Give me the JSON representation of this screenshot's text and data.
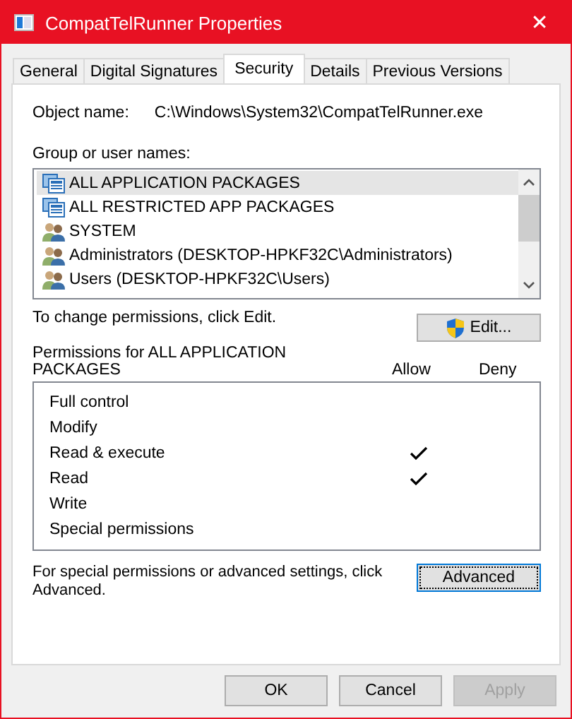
{
  "window": {
    "title": "CompatTelRunner Properties",
    "close": "✕"
  },
  "tabs": [
    {
      "label": "General",
      "selected": false
    },
    {
      "label": "Digital Signatures",
      "selected": false
    },
    {
      "label": "Security",
      "selected": true
    },
    {
      "label": "Details",
      "selected": false
    },
    {
      "label": "Previous Versions",
      "selected": false
    }
  ],
  "object_name": {
    "label": "Object name:",
    "value": "C:\\Windows\\System32\\CompatTelRunner.exe"
  },
  "groups": {
    "label": "Group or user names:",
    "items": [
      {
        "name": "ALL APPLICATION PACKAGES",
        "kind": "package",
        "selected": true
      },
      {
        "name": "ALL RESTRICTED APP PACKAGES",
        "kind": "package",
        "selected": false
      },
      {
        "name": "SYSTEM",
        "kind": "users",
        "selected": false
      },
      {
        "name": "Administrators (DESKTOP-HPKF32C\\Administrators)",
        "kind": "users",
        "selected": false
      },
      {
        "name": "Users (DESKTOP-HPKF32C\\Users)",
        "kind": "users",
        "selected": false
      }
    ]
  },
  "change_hint": "To change permissions, click Edit.",
  "edit_button": "Edit...",
  "permissions": {
    "label": "Permissions for ALL APPLICATION PACKAGES",
    "allow_header": "Allow",
    "deny_header": "Deny",
    "rows": [
      {
        "name": "Full control",
        "allow": false,
        "deny": false
      },
      {
        "name": "Modify",
        "allow": false,
        "deny": false
      },
      {
        "name": "Read & execute",
        "allow": true,
        "deny": false
      },
      {
        "name": "Read",
        "allow": true,
        "deny": false
      },
      {
        "name": "Write",
        "allow": false,
        "deny": false
      },
      {
        "name": "Special permissions",
        "allow": false,
        "deny": false
      }
    ]
  },
  "advanced_hint": "For special permissions or advanced settings, click Advanced.",
  "advanced_button": {
    "label": "Advanced",
    "focused": true
  },
  "buttons": [
    {
      "label": "OK",
      "disabled": false
    },
    {
      "label": "Cancel",
      "disabled": false
    },
    {
      "label": "Apply",
      "disabled": true
    }
  ]
}
